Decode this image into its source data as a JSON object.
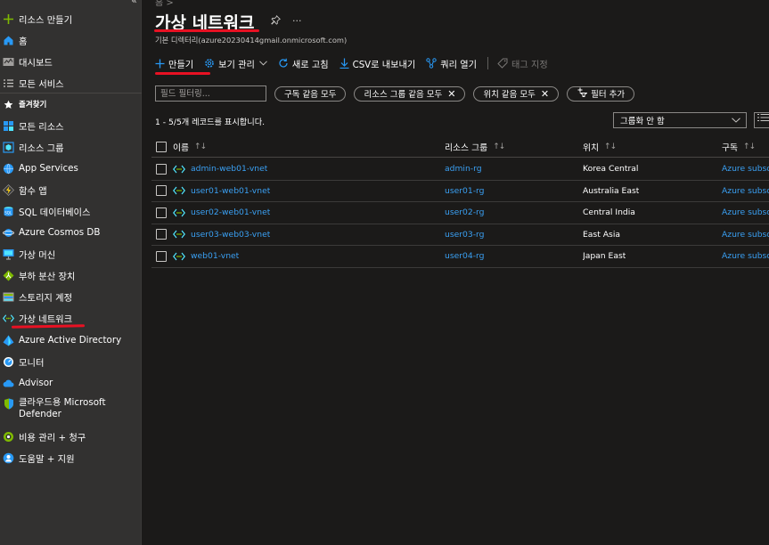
{
  "sidebar": {
    "collapse_glyph": "«",
    "items": [
      {
        "name": "create-resource",
        "label": "리소스 만들기",
        "icon": "plus-icon"
      },
      {
        "name": "home",
        "label": "홈",
        "icon": "home-icon"
      },
      {
        "name": "dashboard",
        "label": "대시보드",
        "icon": "dashboard-icon"
      },
      {
        "name": "all-services",
        "label": "모든 서비스",
        "icon": "list-icon"
      },
      {
        "name": "favorites",
        "label": "즐겨찾기",
        "icon": "star-icon"
      },
      {
        "name": "all-resources",
        "label": "모든 리소스",
        "icon": "grid-icon"
      },
      {
        "name": "resource-groups",
        "label": "리소스 그룹",
        "icon": "cube-icon"
      },
      {
        "name": "app-services",
        "label": "App Services",
        "icon": "globe-icon"
      },
      {
        "name": "function-app",
        "label": "함수 앱",
        "icon": "lightning-icon"
      },
      {
        "name": "sql-databases",
        "label": "SQL 데이터베이스",
        "icon": "sql-icon"
      },
      {
        "name": "cosmos-db",
        "label": "Azure Cosmos DB",
        "icon": "planet-icon"
      },
      {
        "name": "virtual-machines",
        "label": "가상 머신",
        "icon": "monitor-icon"
      },
      {
        "name": "load-balancers",
        "label": "부하 분산 장치",
        "icon": "diamond-icon"
      },
      {
        "name": "storage-accounts",
        "label": "스토리지 계정",
        "icon": "storage-icon"
      },
      {
        "name": "virtual-networks",
        "label": "가상 네트워크",
        "icon": "vnet-icon"
      },
      {
        "name": "azure-ad",
        "label": "Azure Active Directory",
        "icon": "pyramid-icon"
      },
      {
        "name": "monitor",
        "label": "모니터",
        "icon": "gauge-icon"
      },
      {
        "name": "advisor",
        "label": "Advisor",
        "icon": "cloud-icon"
      },
      {
        "name": "defender",
        "label": "클라우드용 Microsoft Defender",
        "icon": "shield-icon"
      },
      {
        "name": "cost-management",
        "label": "비용 관리 + 청구",
        "icon": "cost-icon"
      },
      {
        "name": "help-support",
        "label": "도움말 + 지원",
        "icon": "person-icon"
      }
    ]
  },
  "page": {
    "breadcrumb": "홈 >",
    "title": "가상 네트워크",
    "pin_glyph": "✎",
    "more_glyph": "···",
    "subtitle": "기본 디렉터리(azure20230414gmail.onmicrosoft.com)"
  },
  "toolbar": {
    "create": "만들기",
    "manage_view": "보기 관리",
    "refresh": "새로 고침",
    "export_csv": "CSV로 내보내기",
    "open_query": "쿼리 열기",
    "assign_tags": "태그 지정"
  },
  "filters": {
    "placeholder": "필드 필터링...",
    "subscription": "구독 같음 모두",
    "resource_group": "리소스 그룹 같음 모두",
    "location": "위치 같음 모두",
    "add_filter": "필터 추가"
  },
  "records": {
    "count_text": "1 - 5/5개 레코드를 표시합니다.",
    "grouping": "그룹화 안 함"
  },
  "table": {
    "headers": {
      "name": "이름",
      "resource_group": "리소스 그룹",
      "location": "위치",
      "subscription": "구독"
    },
    "sort_glyph": "↑↓",
    "rows": [
      {
        "name": "admin-web01-vnet",
        "resource_group": "admin-rg",
        "location": "Korea Central",
        "subscription": "Azure subsc"
      },
      {
        "name": "user01-web01-vnet",
        "resource_group": "user01-rg",
        "location": "Australia East",
        "subscription": "Azure subsc"
      },
      {
        "name": "user02-web01-vnet",
        "resource_group": "user02-rg",
        "location": "Central India",
        "subscription": "Azure subsc"
      },
      {
        "name": "user03-web03-vnet",
        "resource_group": "user03-rg",
        "location": "East Asia",
        "subscription": "Azure subsc"
      },
      {
        "name": "web01-vnet",
        "resource_group": "user04-rg",
        "location": "Japan East",
        "subscription": "Azure subsc"
      }
    ]
  },
  "colors": {
    "accent": "#2899f5",
    "link": "#3aa0f3",
    "annotation": "#e81123",
    "sidebar_bg": "#323130",
    "page_bg": "#1b1a19"
  }
}
